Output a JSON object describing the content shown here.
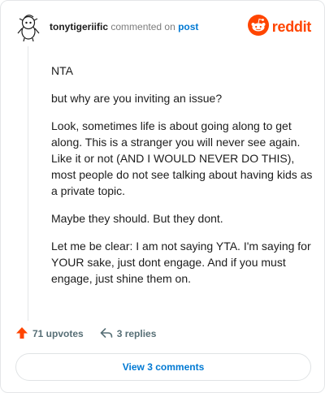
{
  "header": {
    "username": "tonytigeriific",
    "action_text": "commented on",
    "link_text": "post",
    "logo_text": "reddit",
    "avatar_icon": "snoo-avatar-icon",
    "logo_icon": "reddit-alien-icon"
  },
  "comment": {
    "paragraphs": [
      "NTA",
      "but why are you inviting an issue?",
      "Look, sometimes life is about going along to get along. This is a stranger you will never see again. Like it or not (AND I WOULD NEVER DO THIS), most people do not see talking about having kids as a private topic.",
      "Maybe they should. But they dont.",
      "Let me be clear: I am not saying YTA. I'm saying for YOUR sake, just dont engage. And if you must engage, just shine them on."
    ]
  },
  "actions": {
    "upvotes_label": "71 upvotes",
    "replies_label": "3 replies",
    "upvote_icon": "upvote-arrow-icon",
    "reply_icon": "reply-arrow-icon"
  },
  "footer": {
    "view_comments_label": "View 3 comments"
  },
  "colors": {
    "brand": "#ff4500",
    "link": "#0079d3",
    "muted": "#7c7c7c"
  }
}
